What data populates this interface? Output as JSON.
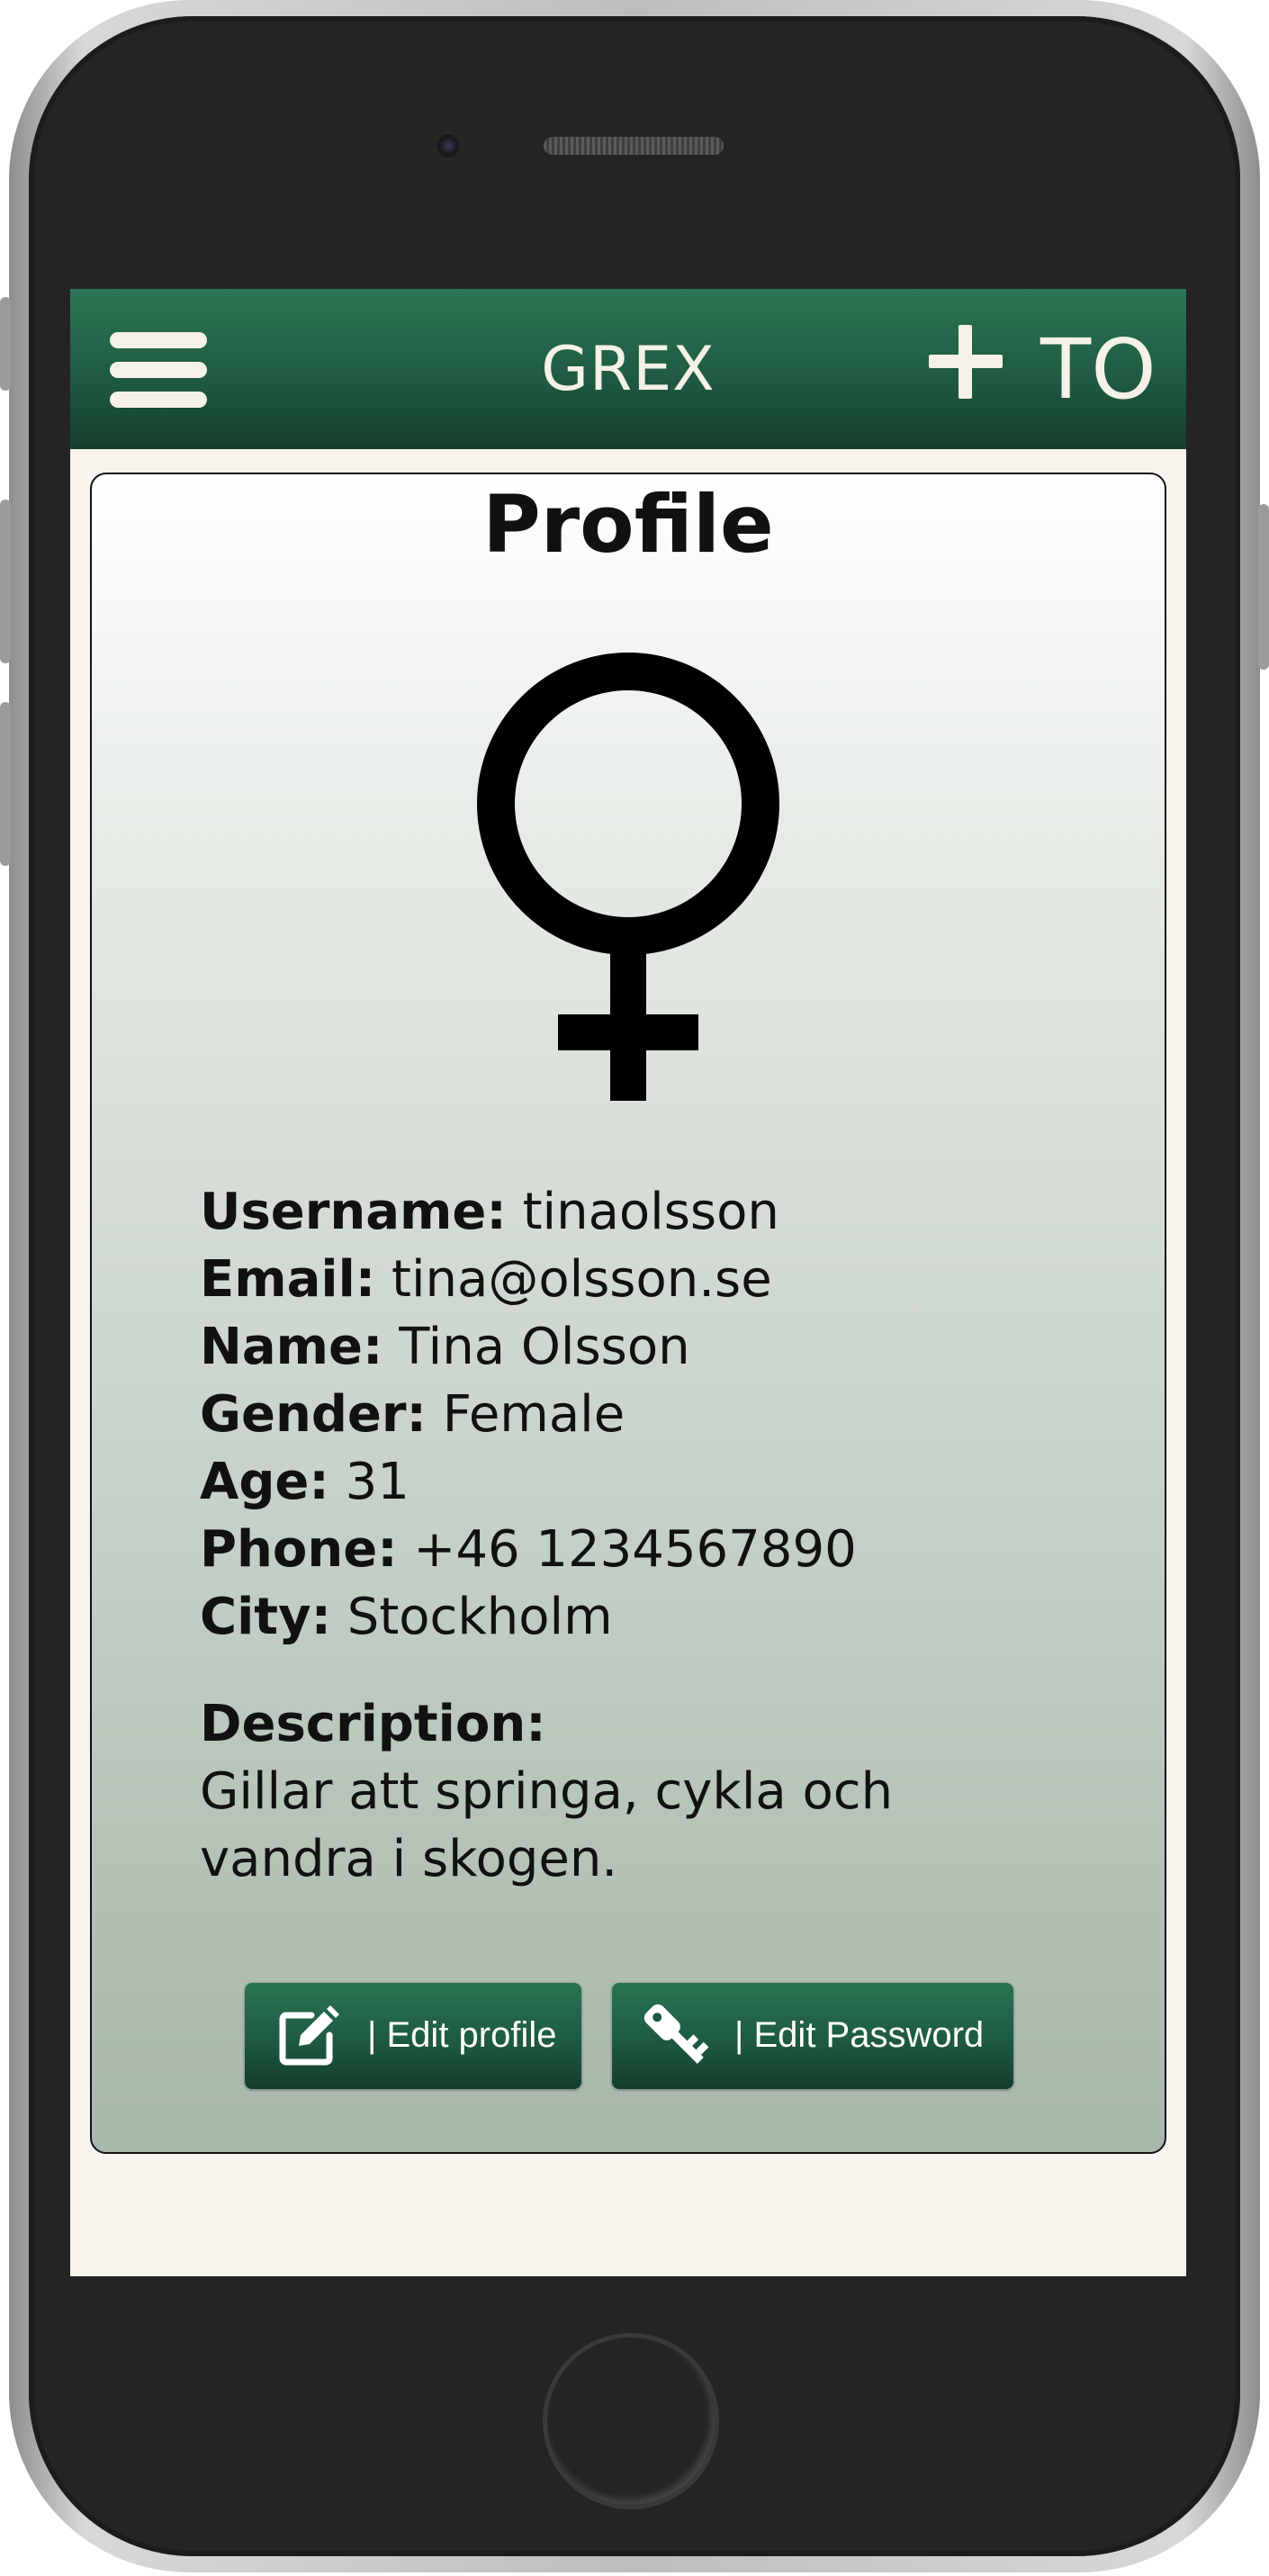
{
  "header": {
    "title": "GREX",
    "right_text": "TO",
    "menu_icon": "hamburger-menu-icon",
    "add_icon": "plus-icon"
  },
  "profile": {
    "title": "Profile",
    "avatar_icon": "female-symbol-icon",
    "fields": [
      {
        "label": "Username:",
        "value": " tinaolsson"
      },
      {
        "label": "Email:",
        "value": " tina@olsson.se"
      },
      {
        "label": "Name:",
        "value": " Tina Olsson"
      },
      {
        "label": "Gender:",
        "value": " Female"
      },
      {
        "label": "Age:",
        "value": " 31"
      },
      {
        "label": "Phone:",
        "value": " +46 1234567890"
      },
      {
        "label": "City:",
        "value": " Stockholm"
      }
    ],
    "description": {
      "label": "Description:",
      "text": "Gillar att springa, cykla och vandra i skogen."
    },
    "buttons": {
      "edit_profile": {
        "label": "| Edit profile",
        "icon": "edit-icon"
      },
      "edit_password": {
        "label": "| Edit Password",
        "icon": "key-icon"
      }
    }
  },
  "colors": {
    "header_green": "#1f5b40",
    "screen_background": "#f6f4ec",
    "button_green": "#1d5a40",
    "header_text": "#f4f1e8"
  }
}
